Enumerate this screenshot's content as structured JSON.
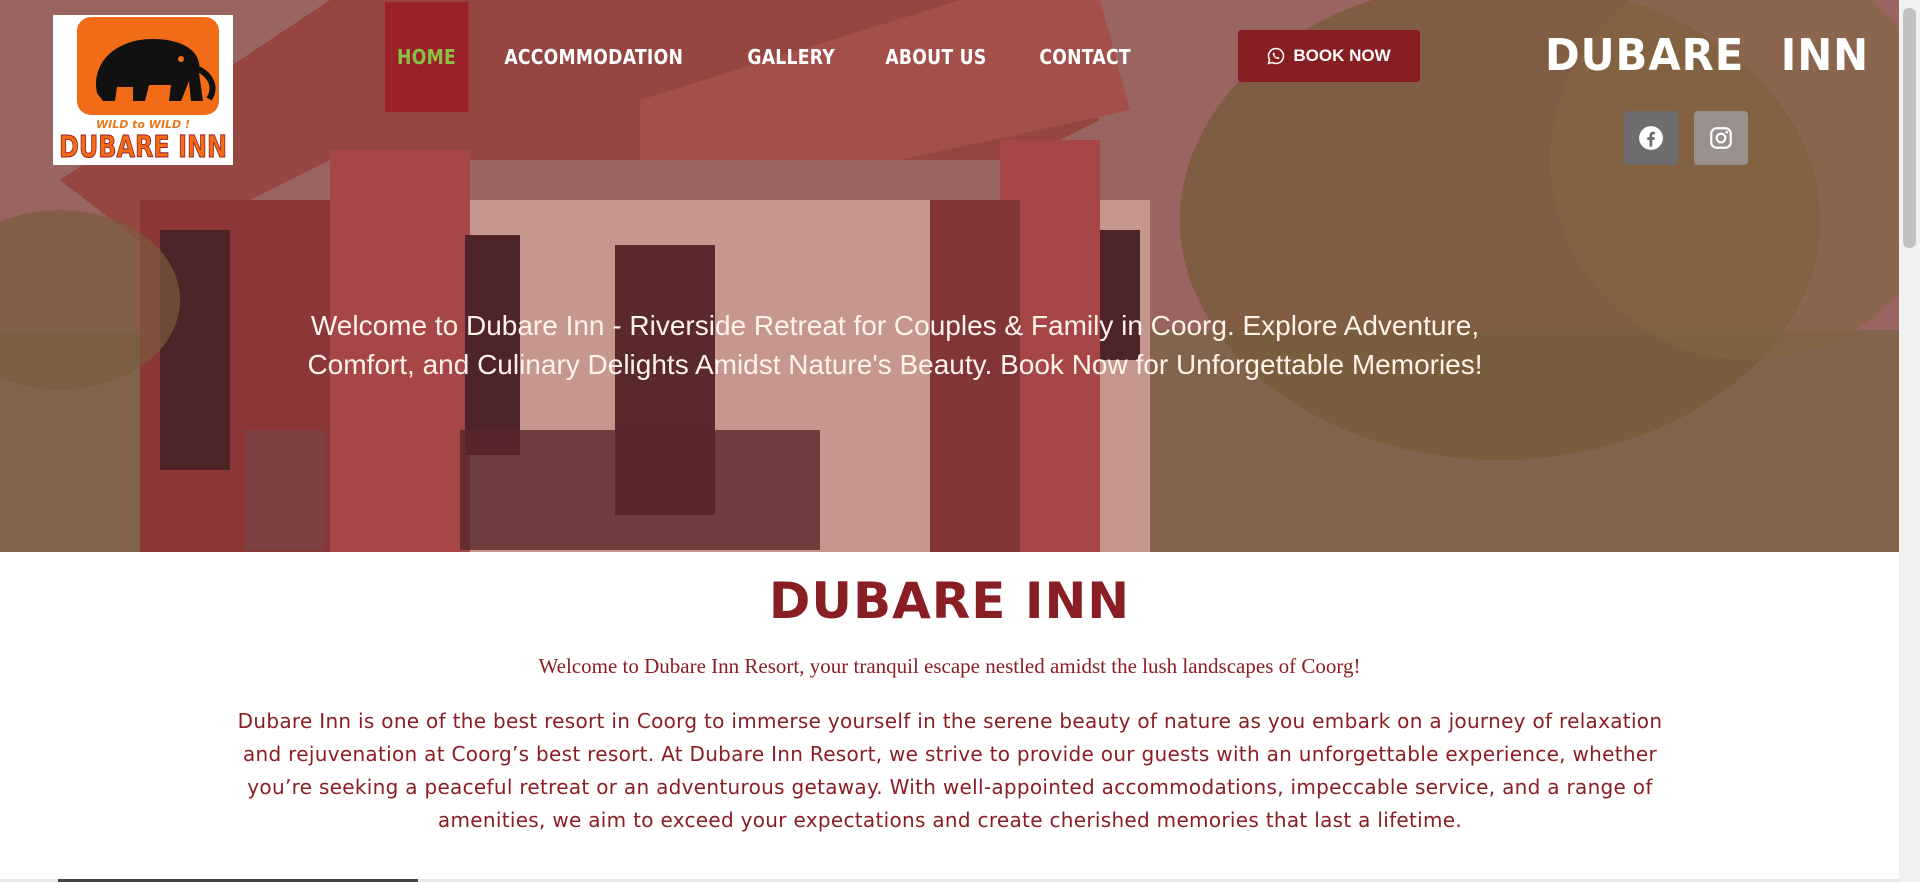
{
  "logo": {
    "tagline": "WILD to WILD !",
    "name": "DUBARE INN"
  },
  "nav": {
    "items": [
      {
        "label": "HOME",
        "active": true
      },
      {
        "label": "ACCOMMODATION",
        "active": false
      },
      {
        "label": "GALLERY",
        "active": false
      },
      {
        "label": "ABOUT US",
        "active": false
      },
      {
        "label": "CONTACT",
        "active": false
      }
    ]
  },
  "book_button": {
    "label": "BOOK NOW",
    "icon": "whatsapp-icon"
  },
  "brand": {
    "text": "DUBARE INN"
  },
  "social": [
    {
      "name": "facebook-icon",
      "color": "#6e6e6e"
    },
    {
      "name": "instagram-icon",
      "color": "#9a8f8f"
    }
  ],
  "hero": {
    "text": "Welcome to Dubare Inn - Riverside Retreat for Couples & Family in Coorg. Explore Adventure, Comfort, and Culinary Delights Amidst Nature's Beauty. Book Now for Unforgettable Memories!"
  },
  "main": {
    "title": "DUBARE INN",
    "intro": "Welcome to Dubare Inn Resort, your tranquil escape nestled amidst the lush landscapes of Coorg!",
    "description": "Dubare Inn is one of the best resort in Coorg to immerse yourself in the serene beauty of nature as you embark on a journey of relaxation and rejuvenation at Coorg’s best resort. At Dubare Inn Resort, we strive to provide our guests with an unforgettable experience, whether you’re seeking a peaceful retreat or an adventurous getaway. With well-appointed accommodations, impeccable service, and a range of amenities, we aim to exceed your expectations and create cherished memories that last a lifetime."
  },
  "colors": {
    "brand_red": "#891f24",
    "active_nav_bg": "#9a2128",
    "active_nav_text": "#8ac145",
    "logo_orange": "#f26b16"
  }
}
